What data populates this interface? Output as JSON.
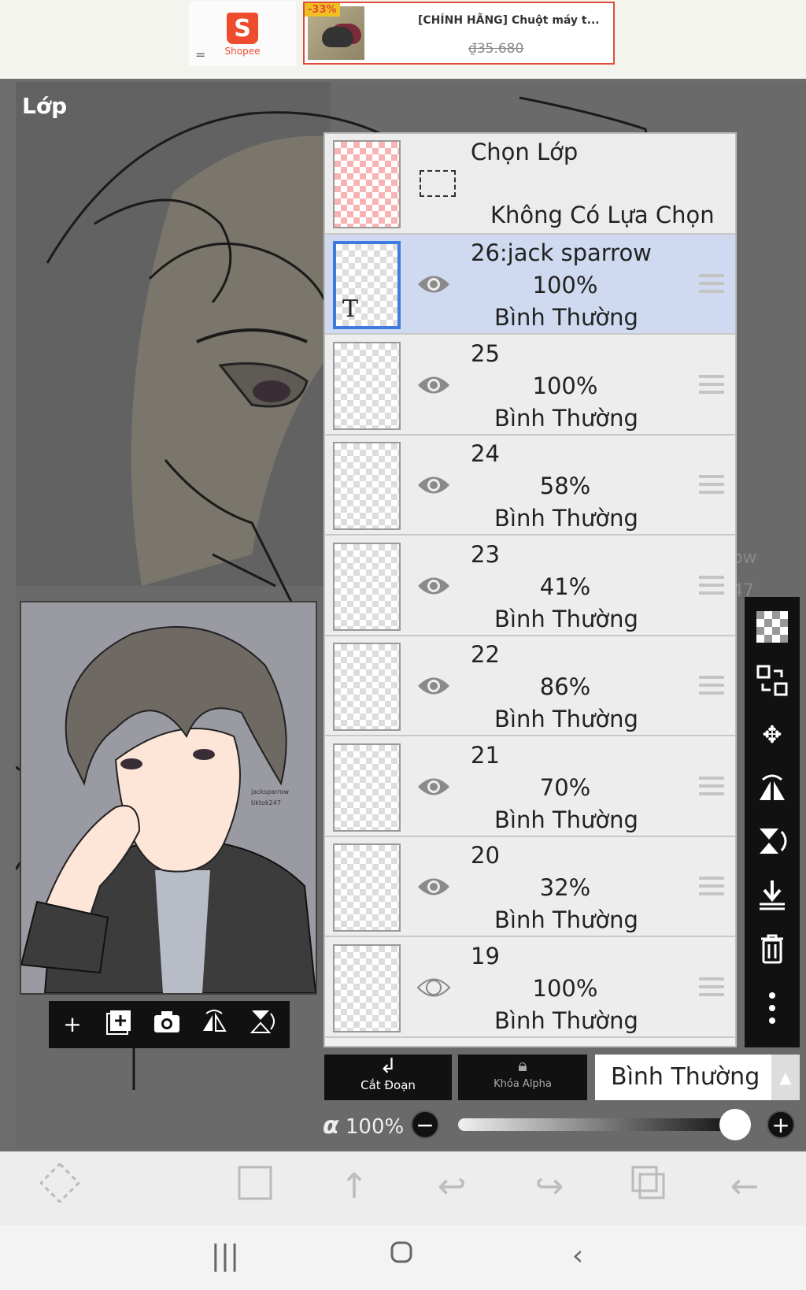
{
  "ad": {
    "shop_name": "Shopee",
    "shop_letter": "S",
    "menu_glyph": "=",
    "discount": "-33%",
    "product_title": "[CHÍNH HÃNG] Chuột máy t...",
    "price": "₫35.680",
    "brand_color": "#ee4d2d"
  },
  "panel": {
    "title": "Lớp"
  },
  "selection_row": {
    "label": "Chọn Lớp",
    "status": "Không Có Lựa Chọn"
  },
  "layers": [
    {
      "name": "26:jack sparrow",
      "opacity": "100%",
      "mode": "Bình Thường",
      "selected": true,
      "visible": true,
      "thumb": "text-T"
    },
    {
      "name": "25",
      "opacity": "100%",
      "mode": "Bình Thường",
      "selected": false,
      "visible": true
    },
    {
      "name": "24",
      "opacity": "58%",
      "mode": "Bình Thường",
      "selected": false,
      "visible": true
    },
    {
      "name": "23",
      "opacity": "41%",
      "mode": "Bình Thường",
      "selected": false,
      "visible": true
    },
    {
      "name": "22",
      "opacity": "86%",
      "mode": "Bình Thường",
      "selected": false,
      "visible": true
    },
    {
      "name": "21",
      "opacity": "70%",
      "mode": "Bình Thường",
      "selected": false,
      "visible": true
    },
    {
      "name": "20",
      "opacity": "32%",
      "mode": "Bình Thường",
      "selected": false,
      "visible": true
    },
    {
      "name": "19",
      "opacity": "100%",
      "mode": "Bình Thường",
      "selected": false,
      "visible": false
    }
  ],
  "bottom": {
    "clip_label": "Cắt Đoạn",
    "alpha_lock_label": "Khóa Alpha",
    "blend_mode": "Bình Thường",
    "alpha_symbol": "α",
    "alpha_value": "100%",
    "opacity_level": 1.0
  },
  "thumb_text": "T",
  "canvas_bg_text": {
    "line1": "ow",
    "line2": "47"
  },
  "preview_caption": {
    "line1": "jacksparrow",
    "line2": "tiktok247"
  },
  "icons": {
    "preview_tools": [
      "plus-icon",
      "add-layer-icon",
      "camera-icon",
      "flip-horizontal-icon",
      "flip-vertical-icon"
    ],
    "right_tools": [
      "transparency-icon",
      "layer-swap-icon",
      "move-icon",
      "flip-horizontal-icon",
      "flip-vertical-icon",
      "merge-down-icon",
      "trash-icon",
      "more-icon"
    ],
    "app_tools": [
      "select-icon",
      "square-icon",
      "up-arrow-icon",
      "undo-icon",
      "redo-icon",
      "layers-icon",
      "back-icon"
    ],
    "nav": [
      "recents-icon",
      "home-icon",
      "back-icon"
    ]
  },
  "colors": {
    "selection_highlight": "#cfdaf0",
    "selected_border": "#3f7ae0",
    "ad_border": "#e24b3b"
  }
}
